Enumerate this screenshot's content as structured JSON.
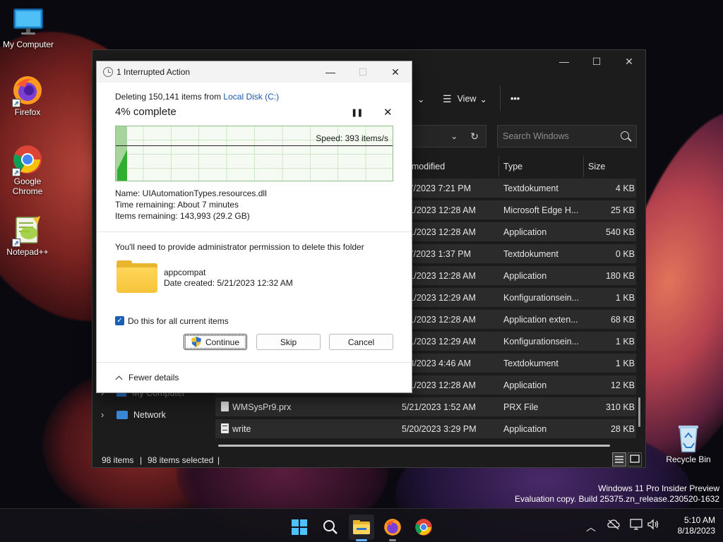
{
  "desktop": {
    "icons": [
      {
        "label": "My Computer"
      },
      {
        "label": "Firefox"
      },
      {
        "label": "Google Chrome"
      },
      {
        "label": "Notepad++"
      },
      {
        "label": "Recycle Bin"
      }
    ],
    "watermark": {
      "line1": "Windows 11 Pro Insider Preview",
      "line2": "Evaluation copy. Build 25375.zn_release.230520-1632"
    }
  },
  "explorer": {
    "toolbar": {
      "view_label": "View",
      "more_label": "•••"
    },
    "search_placeholder": "Search Windows",
    "columns": {
      "date": "te modified",
      "type": "Type",
      "size": "Size"
    },
    "files": [
      {
        "name": "",
        "date": "27/2023 7:21 PM",
        "type": "Textdokument",
        "size": "4 KB"
      },
      {
        "name": "",
        "date": "/21/2023 12:28 AM",
        "type": "Microsoft Edge H...",
        "size": "25 KB"
      },
      {
        "name": "",
        "date": "/21/2023 12:28 AM",
        "type": "Application",
        "size": "540 KB"
      },
      {
        "name": "",
        "date": "27/2023 1:37 PM",
        "type": "Textdokument",
        "size": "0 KB"
      },
      {
        "name": "",
        "date": "/21/2023 12:28 AM",
        "type": "Application",
        "size": "180 KB"
      },
      {
        "name": "",
        "date": "/21/2023 12:29 AM",
        "type": "Konfigurationsein...",
        "size": "1 KB"
      },
      {
        "name": "",
        "date": "/21/2023 12:28 AM",
        "type": "Application exten...",
        "size": "68 KB"
      },
      {
        "name": "",
        "date": "/21/2023 12:29 AM",
        "type": "Konfigurationsein...",
        "size": "1 KB"
      },
      {
        "name": "",
        "date": "/8/2023 4:46 AM",
        "type": "Textdokument",
        "size": "1 KB"
      },
      {
        "name": "",
        "date": "/21/2023 12:28 AM",
        "type": "Application",
        "size": "12 KB"
      },
      {
        "name": "WMSysPr9.prx",
        "date": "5/21/2023 1:52 AM",
        "type": "PRX File",
        "size": "310 KB"
      },
      {
        "name": "write",
        "date": "5/20/2023 3:29 PM",
        "type": "Application",
        "size": "28 KB"
      }
    ],
    "nav": {
      "my_computer": "My Computer",
      "network": "Network"
    },
    "status": {
      "items": "98 items",
      "selected": "98 items selected"
    }
  },
  "dialog": {
    "title": "1 Interrupted Action",
    "deleting_prefix": "Deleting 150,141 items from ",
    "deleting_location": "Local Disk (C:)",
    "percent_text": "4% complete",
    "progress_fraction": 0.04,
    "speed_text": "Speed: 393 items/s",
    "name_line": "Name:  UIAutomationTypes.resources.dll",
    "time_line": "Time remaining:  About 7 minutes",
    "items_line": "Items remaining:  143,993 (29.2 GB)",
    "permission_text": "You'll need to provide administrator permission to delete this folder",
    "folder_name": "appcompat",
    "folder_date": "Date created: 5/21/2023 12:32 AM",
    "checkbox_label": "Do this for all current items",
    "checkbox_checked": true,
    "buttons": {
      "continue": "Continue",
      "skip": "Skip",
      "cancel": "Cancel"
    },
    "fewer_details": "Fewer details"
  },
  "taskbar": {
    "time": "5:10 AM",
    "date": "8/18/2023"
  },
  "colors": {
    "accent": "#1a5fb4",
    "link": "#1a56a8",
    "graph_green": "#2fae2f"
  }
}
